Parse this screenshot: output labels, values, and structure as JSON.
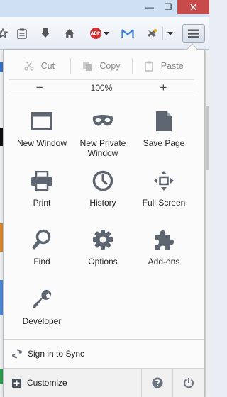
{
  "window": {
    "minimize_glyph": "—",
    "maximize_glyph": "❐",
    "close_glyph": "✕"
  },
  "toolbar": {
    "icons": [
      "star-icon",
      "reading-list-icon",
      "download-icon",
      "home-icon",
      "adblock-icon",
      "gmail-icon",
      "extension-icon",
      "hamburger-menu-icon"
    ],
    "abp_text": "ABP"
  },
  "menu": {
    "edit": {
      "cut": "Cut",
      "copy": "Copy",
      "paste": "Paste"
    },
    "zoom": {
      "minus": "−",
      "value": "100%",
      "plus": "+"
    },
    "items": [
      {
        "label": "New Window",
        "icon": "new-window-icon"
      },
      {
        "label": "New Private Window",
        "icon": "private-mask-icon"
      },
      {
        "label": "Save Page",
        "icon": "save-page-icon"
      },
      {
        "label": "Print",
        "icon": "printer-icon"
      },
      {
        "label": "History",
        "icon": "clock-icon"
      },
      {
        "label": "Full Screen",
        "icon": "fullscreen-icon"
      },
      {
        "label": "Find",
        "icon": "magnifier-icon"
      },
      {
        "label": "Options",
        "icon": "gear-icon"
      },
      {
        "label": "Add-ons",
        "icon": "puzzle-icon"
      },
      {
        "label": "Developer",
        "icon": "wrench-icon"
      }
    ],
    "sync_label": "Sign in to Sync",
    "customize_label": "Customize",
    "help_icon": "help-icon",
    "quit_icon": "power-icon"
  },
  "colors": {
    "icon_gray": "#5c6570",
    "close_red": "#c74b4b",
    "gmail_blue": "#3b7fd8",
    "abp_red": "#cc3333"
  }
}
